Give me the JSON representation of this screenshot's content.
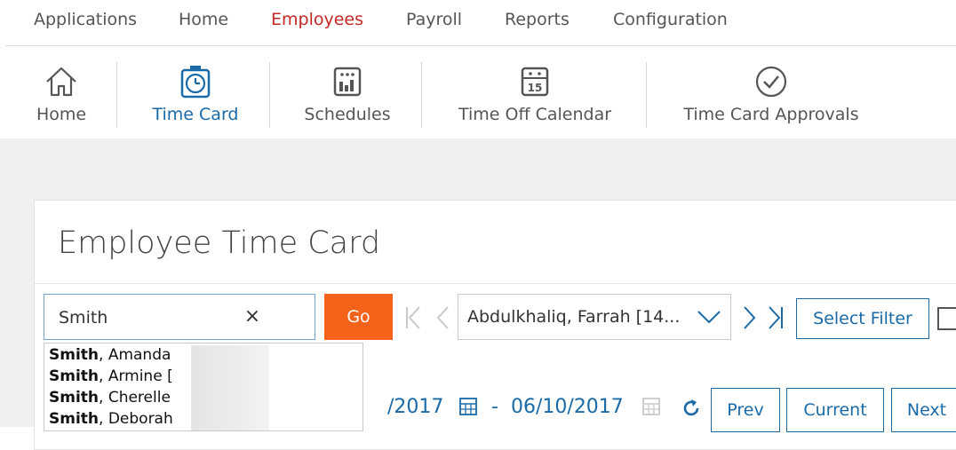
{
  "topnav": {
    "items": [
      {
        "label": "Applications"
      },
      {
        "label": "Home"
      },
      {
        "label": "Employees"
      },
      {
        "label": "Payroll"
      },
      {
        "label": "Reports"
      },
      {
        "label": "Configuration"
      }
    ],
    "active": "Employees"
  },
  "toolbar": {
    "items": [
      {
        "label": "Home",
        "icon": "house-icon"
      },
      {
        "label": "Time Card",
        "icon": "stopwatch-icon"
      },
      {
        "label": "Schedules",
        "icon": "schedule-calendar-icon"
      },
      {
        "label": "Time Off Calendar",
        "icon": "calendar-15-icon"
      },
      {
        "label": "Time Card Approvals",
        "icon": "checkmark-circle-icon"
      }
    ],
    "active": "Time Card"
  },
  "page": {
    "title": "Employee Time Card"
  },
  "search": {
    "value": "Smith",
    "clear_glyph": "×",
    "go_label": "Go"
  },
  "employee_select": {
    "value": "Abdulkhaliq, Farrah [14..."
  },
  "filter": {
    "label": "Select Filter"
  },
  "dropdown": {
    "items": [
      {
        "match": "Smith",
        "rest": ", Amanda"
      },
      {
        "match": "Smith",
        "rest": ", Armine ["
      },
      {
        "match": "Smith",
        "rest": ", Cherelle"
      },
      {
        "match": "Smith",
        "rest": ", Deborah"
      }
    ]
  },
  "date_range": {
    "start_partial": "/2017",
    "separator": "-",
    "end": "06/10/2017"
  },
  "period_buttons": {
    "prev": "Prev",
    "current": "Current",
    "next": "Next"
  },
  "colors": {
    "accent_blue": "#1a6aa8",
    "active_red": "#c62828",
    "go_orange": "#f5621a"
  }
}
